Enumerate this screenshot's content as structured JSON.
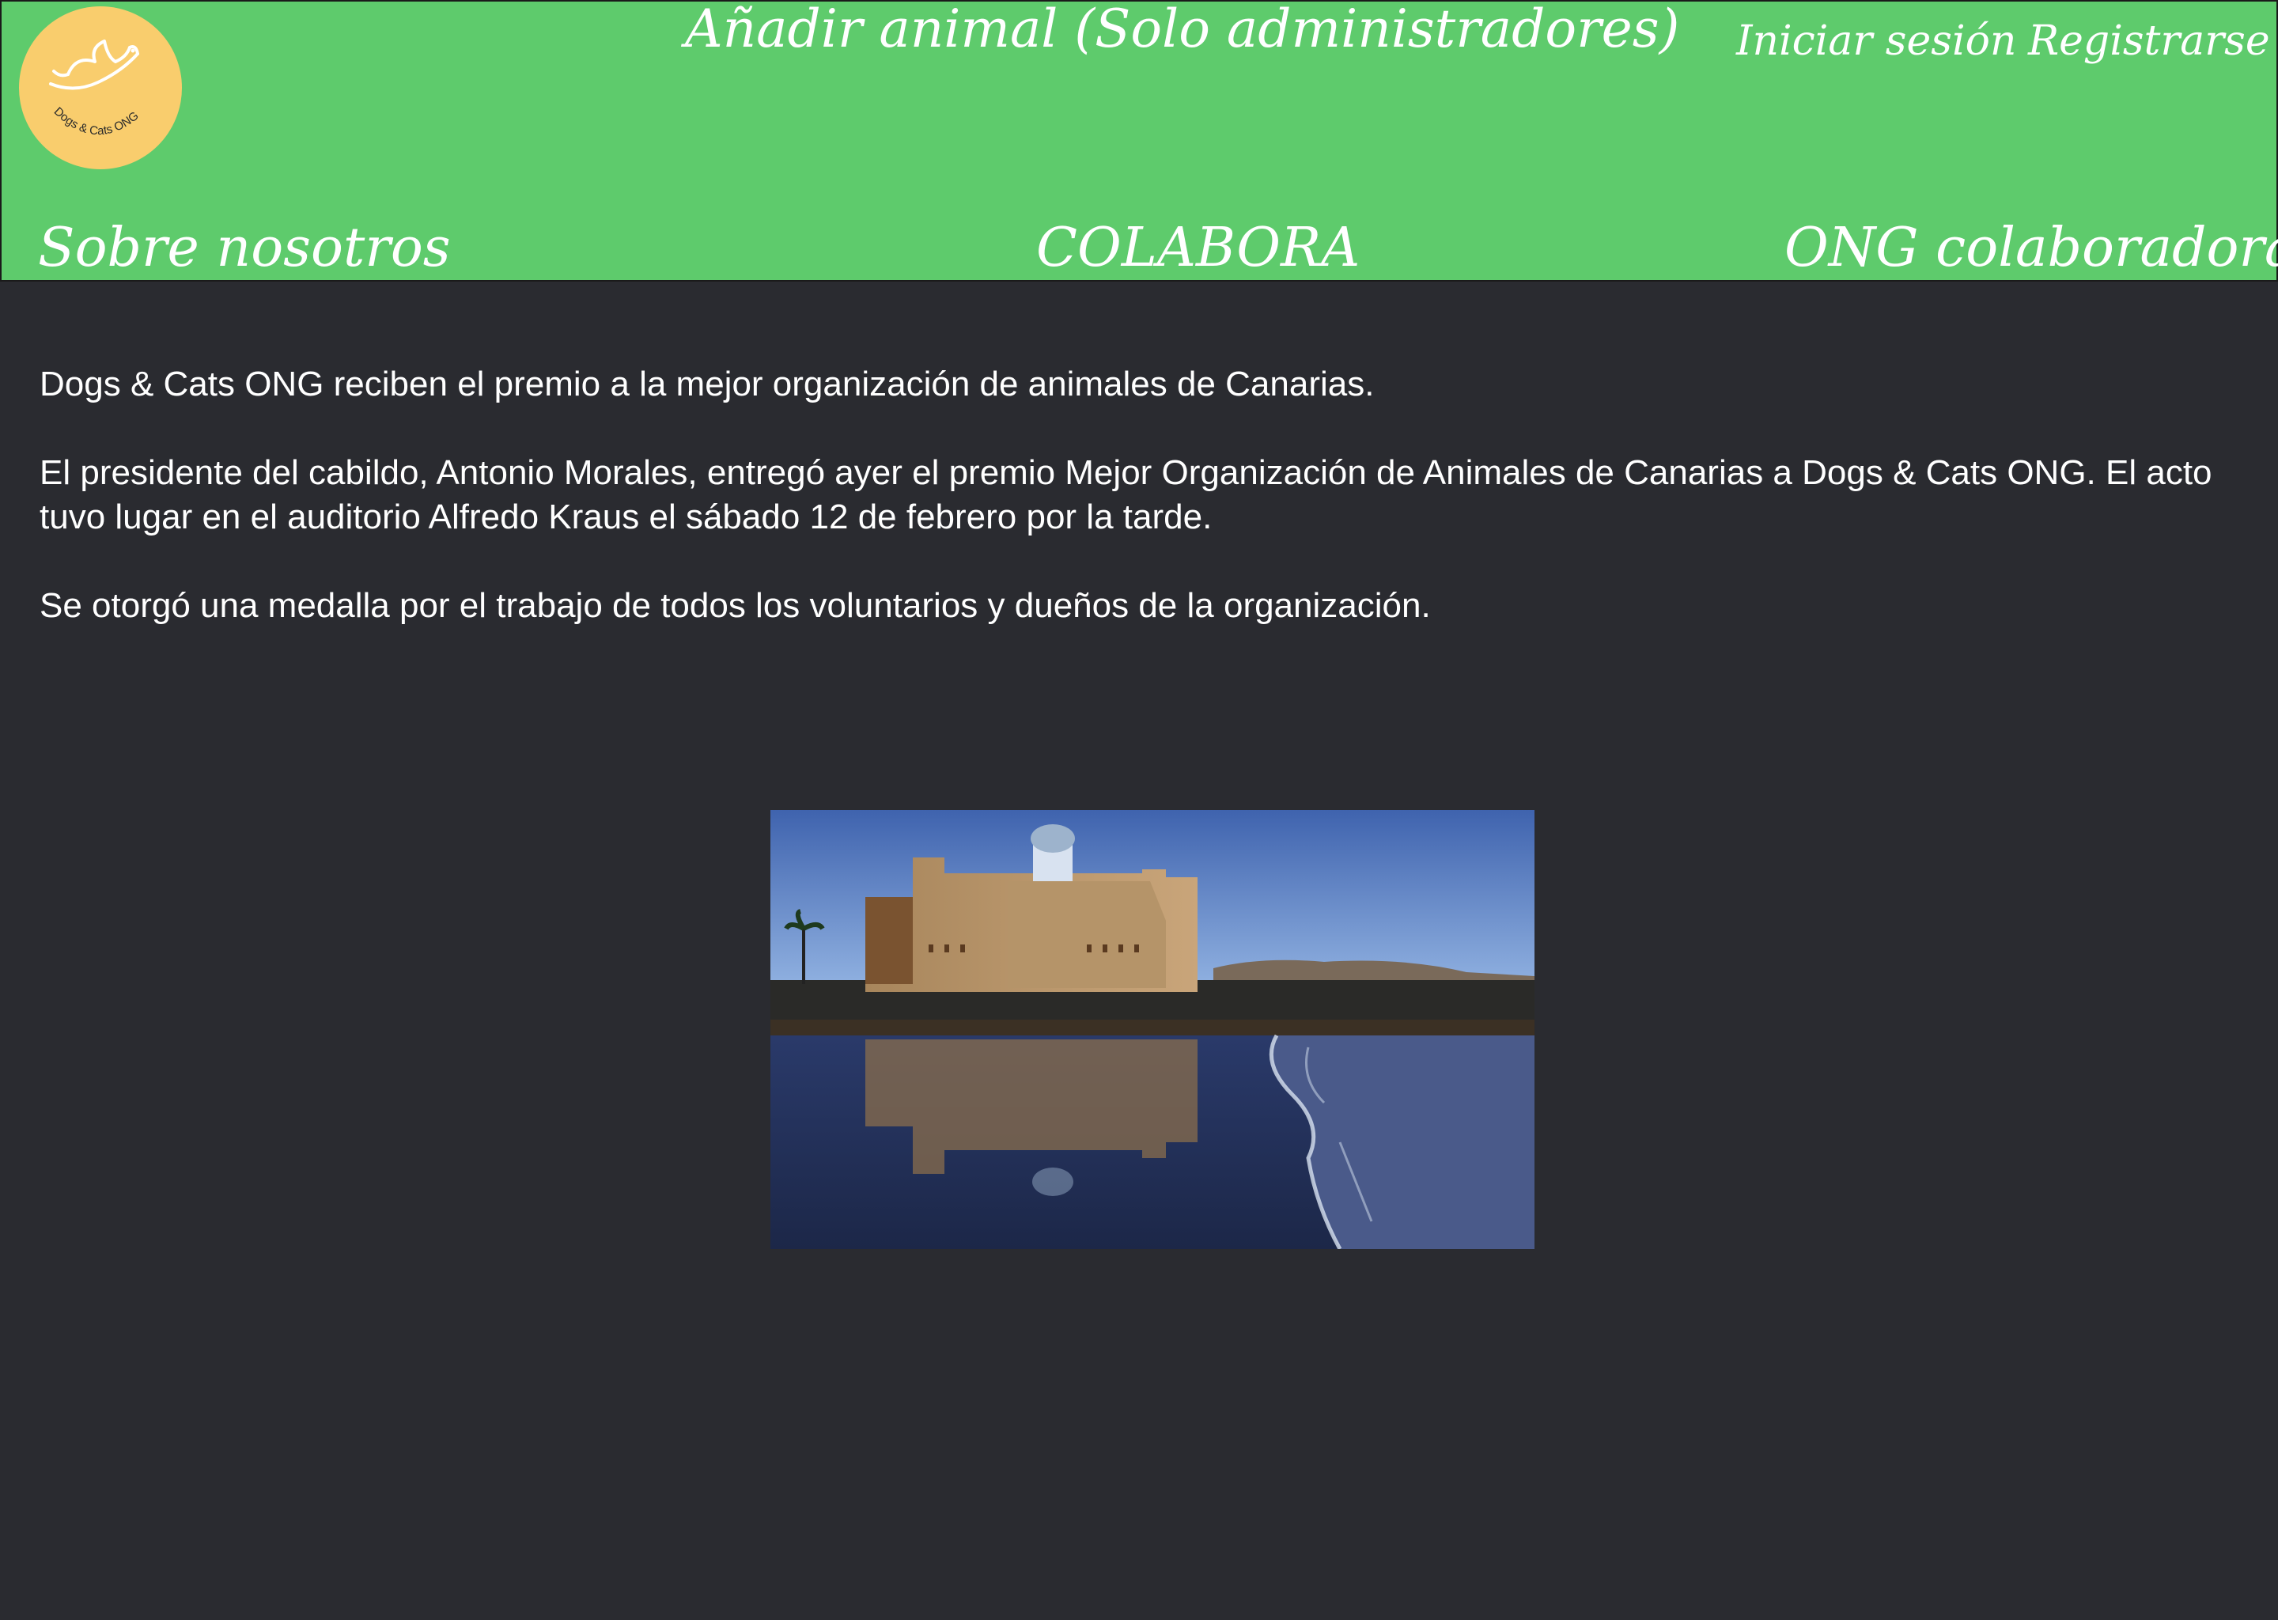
{
  "header": {
    "logo_text": "Dogs & Cats ONG",
    "admin_link": "Añadir animal (Solo administradores)",
    "login_link": "Iniciar sesión",
    "register_link": "Registrarse",
    "nav": {
      "about": "Sobre nosotros",
      "colabora": "COLABORA",
      "ong": "ONG colaboradoras"
    }
  },
  "article": {
    "headline": "Dogs & Cats ONG reciben el premio a la mejor organización de animales de Canarias.",
    "paragraph1": "El presidente del cabildo, Antonio Morales, entregó ayer el premio Mejor Organización de Animales de Canarias a Dogs & Cats ONG. El acto tuvo lugar en el auditorio Alfredo Kraus el sábado 12 de febrero por la tarde.",
    "paragraph2": "Se otorgó una medalla por el trabajo de todos los voluntarios y dueños de la organización."
  },
  "colors": {
    "header_bg": "#5ecb6c",
    "page_bg": "#2a2b30",
    "logo_bg": "#f9cd6d",
    "text": "#ffffff"
  }
}
